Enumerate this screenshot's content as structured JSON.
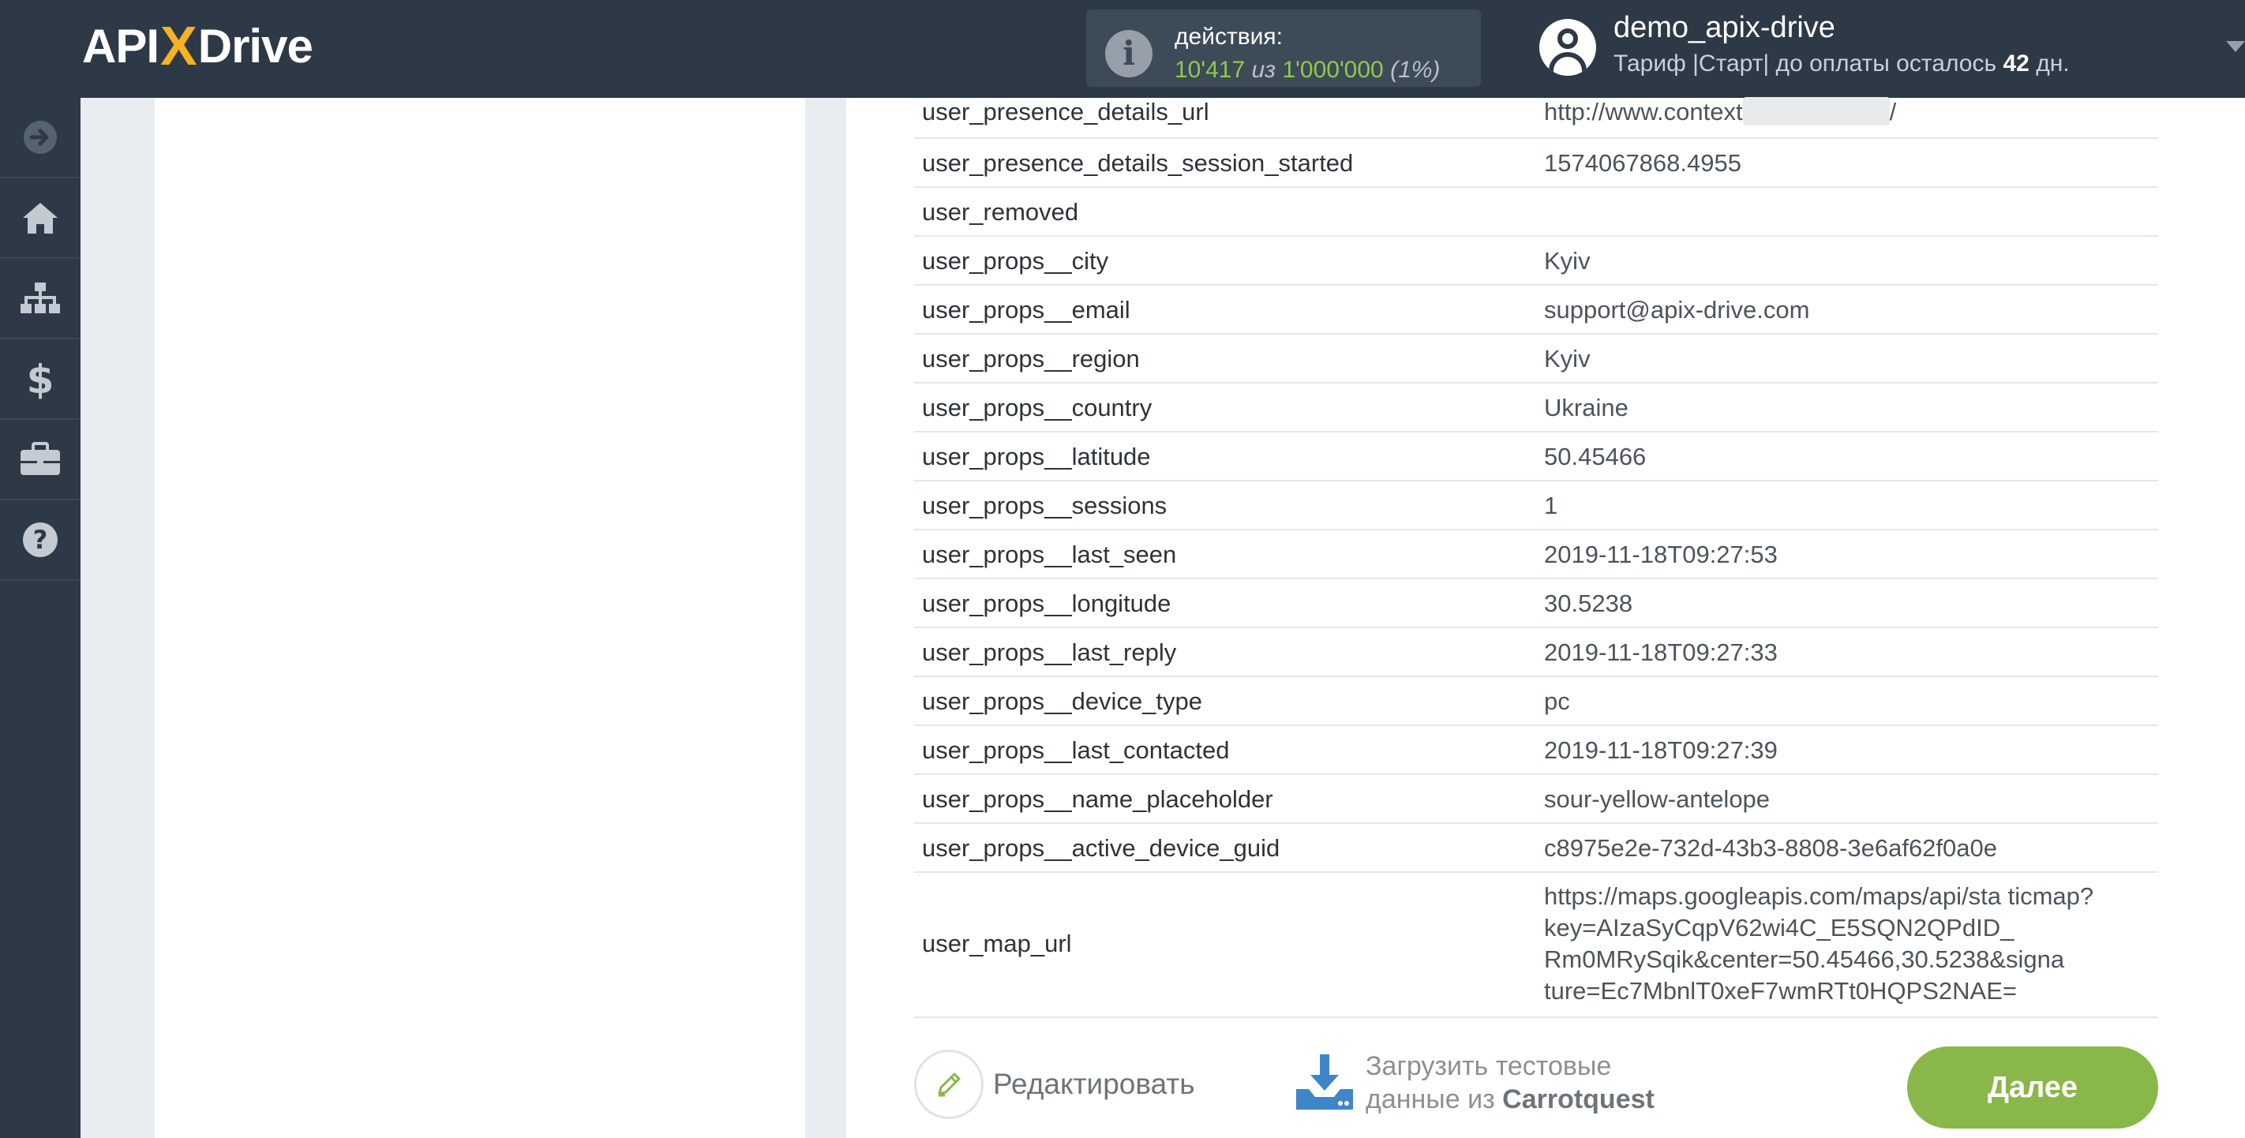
{
  "brand": {
    "logo_left": "API",
    "logo_x": "X",
    "logo_right": "Drive"
  },
  "actions": {
    "label": "действия:",
    "used": "10'417",
    "of_word": "из",
    "total": "1'000'000",
    "percent": "(1%)"
  },
  "user": {
    "name": "demo_apix-drive",
    "plan_prefix": "Тариф |Старт| до оплаты осталось",
    "days": "42",
    "days_suffix": "дн."
  },
  "sidebar": {
    "items": [
      {
        "icon": "arrow-right-circle-icon"
      },
      {
        "icon": "home-icon"
      },
      {
        "icon": "sitemap-icon"
      },
      {
        "icon": "dollar-icon"
      },
      {
        "icon": "briefcase-icon"
      },
      {
        "icon": "help-circle-icon"
      }
    ]
  },
  "table": {
    "rows": [
      {
        "key": "user_presence_details_url",
        "value": "http://www.context",
        "value_tail": "/",
        "redacted": true
      },
      {
        "key": "user_presence_details_session_started",
        "value": "1574067868.4955"
      },
      {
        "key": "user_removed",
        "value": ""
      },
      {
        "key": "user_props__city",
        "value": "Kyiv"
      },
      {
        "key": "user_props__email",
        "value": "support@apix-drive.com"
      },
      {
        "key": "user_props__region",
        "value": "Kyiv"
      },
      {
        "key": "user_props__country",
        "value": "Ukraine"
      },
      {
        "key": "user_props__latitude",
        "value": "50.45466"
      },
      {
        "key": "user_props__sessions",
        "value": "1"
      },
      {
        "key": "user_props__last_seen",
        "value": "2019-11-18T09:27:53"
      },
      {
        "key": "user_props__longitude",
        "value": "30.5238"
      },
      {
        "key": "user_props__last_reply",
        "value": "2019-11-18T09:27:33"
      },
      {
        "key": "user_props__device_type",
        "value": "pc"
      },
      {
        "key": "user_props__last_contacted",
        "value": "2019-11-18T09:27:39"
      },
      {
        "key": "user_props__name_placeholder",
        "value": "sour-yellow-antelope"
      },
      {
        "key": "user_props__active_device_guid",
        "value": "c8975e2e-732d-43b3-8808-3e6af62f0a0e"
      }
    ],
    "map_row": {
      "key": "user_map_url",
      "lines": [
        "https://maps.googleapis.com/maps/api/sta ticmap?",
        "key=AIzaSyCqpV62wi4C_E5SQN2QPdID_",
        "Rm0MRySqik&center=50.45466,30.5238&signa",
        "ture=Ec7MbnlT0xeF7wmRTt0HQPS2NAE="
      ]
    }
  },
  "footer": {
    "edit_label": "Редактировать",
    "load_line1": "Загрузить тестовые",
    "load_line2_prefix": "данные из",
    "load_source": "Carrotquest",
    "next_label": "Далее"
  }
}
